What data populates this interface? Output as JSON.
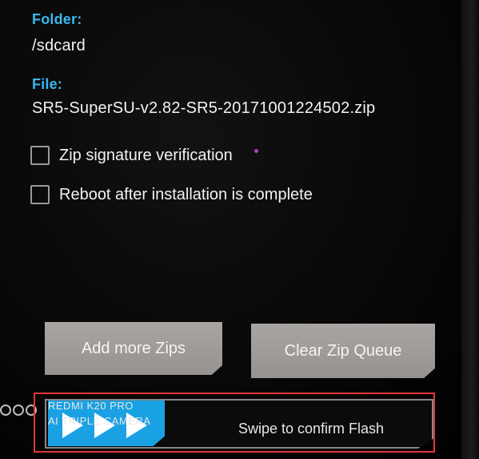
{
  "install": {
    "folder_label": "Folder:",
    "folder_value": "/sdcard",
    "file_label": "File:",
    "file_value": "SR5-SuperSU-v2.82-SR5-20171001224502.zip",
    "options": [
      {
        "label": "Zip signature verification",
        "checked": false
      },
      {
        "label": "Reboot after installation is complete",
        "checked": false
      }
    ]
  },
  "buttons": {
    "add_more": "Add more Zips",
    "clear_queue": "Clear Zip Queue"
  },
  "swipe": {
    "label": "Swipe to confirm Flash"
  },
  "watermark": {
    "line1": "REDMI K20 PRO",
    "line2": "AI TRIPLE CAMERA"
  },
  "colors": {
    "accent_blue": "#3ab7f0",
    "handle_blue": "#1aa1e3",
    "highlight_red": "#e0363a",
    "button_gray": "#a09c99"
  }
}
